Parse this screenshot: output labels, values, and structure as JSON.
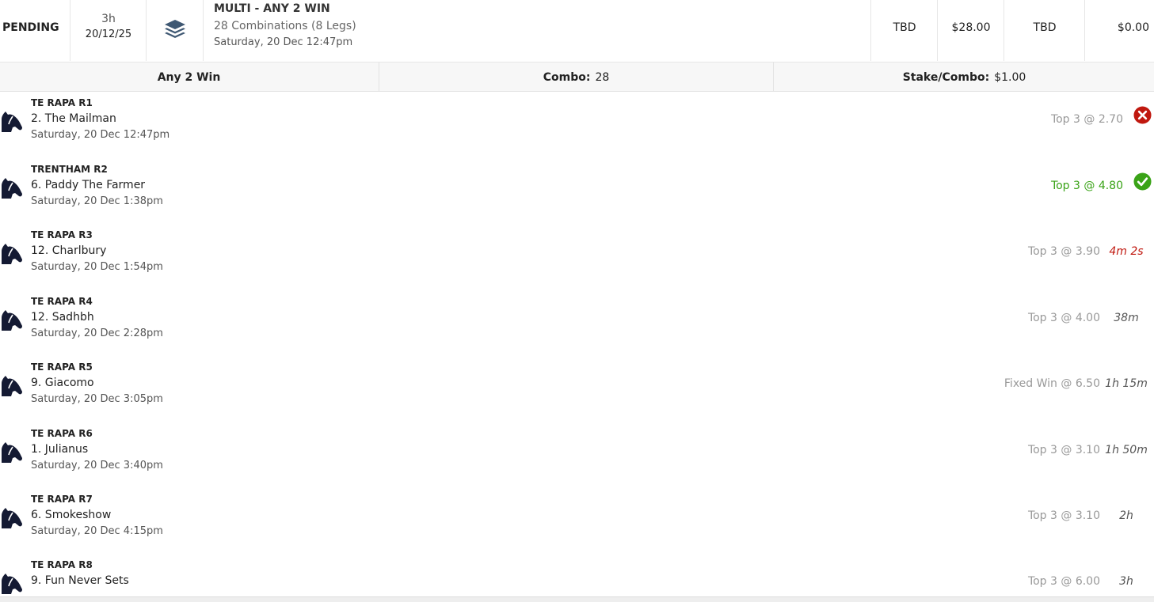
{
  "bet": {
    "status": "PENDING",
    "time_ago": "3h",
    "date": "20/12/25",
    "type_icon": "layers-icon",
    "title": "MULTI - ANY 2 WIN",
    "combinations": "28 Combinations (8 Legs)",
    "placed": "Saturday, 20 Dec 12:47pm",
    "col1": "TBD",
    "stake": "$28.00",
    "col3": "TBD",
    "payout": "$0.00"
  },
  "summary": {
    "type_label": "Any 2 Win",
    "combo_label": "Combo:",
    "combo_value": "28",
    "stake_label": "Stake/Combo:",
    "stake_value": "$1.00"
  },
  "colors": {
    "win": "#3aa317",
    "loss": "#c0180f",
    "horse_icon": "#141a33",
    "muted": "#999999"
  },
  "legs": [
    {
      "race": "TE RAPA R1",
      "runner": "2. The Mailman",
      "time": "Saturday, 20 Dec 12:47pm",
      "odds": "Top 3 @ 2.70",
      "result": "lost",
      "icon": "close-circle-icon"
    },
    {
      "race": "TRENTHAM R2",
      "runner": "6. Paddy The Farmer",
      "time": "Saturday, 20 Dec 1:38pm",
      "odds": "Top 3 @ 4.80",
      "result": "won",
      "icon": "check-circle-icon"
    },
    {
      "race": "TE RAPA R3",
      "runner": "12. Charlbury",
      "time": "Saturday, 20 Dec 1:54pm",
      "odds": "Top 3 @ 3.90",
      "countdown": "4m 2s"
    },
    {
      "race": "TE RAPA R4",
      "runner": "12. Sadhbh",
      "time": "Saturday, 20 Dec 2:28pm",
      "odds": "Top 3 @ 4.00",
      "countdown": "38m"
    },
    {
      "race": "TE RAPA R5",
      "runner": "9. Giacomo",
      "time": "Saturday, 20 Dec 3:05pm",
      "odds": "Fixed Win @ 6.50",
      "countdown": "1h 15m"
    },
    {
      "race": "TE RAPA R6",
      "runner": "1. Julianus",
      "time": "Saturday, 20 Dec 3:40pm",
      "odds": "Top 3 @ 3.10",
      "countdown": "1h 50m"
    },
    {
      "race": "TE RAPA R7",
      "runner": "6. Smokeshow",
      "time": "Saturday, 20 Dec 4:15pm",
      "odds": "Top 3 @ 3.10",
      "countdown": "2h"
    },
    {
      "race": "TE RAPA R8",
      "runner": "9. Fun Never Sets",
      "time": "",
      "odds": "Top 3 @ 6.00",
      "countdown": "3h"
    }
  ]
}
